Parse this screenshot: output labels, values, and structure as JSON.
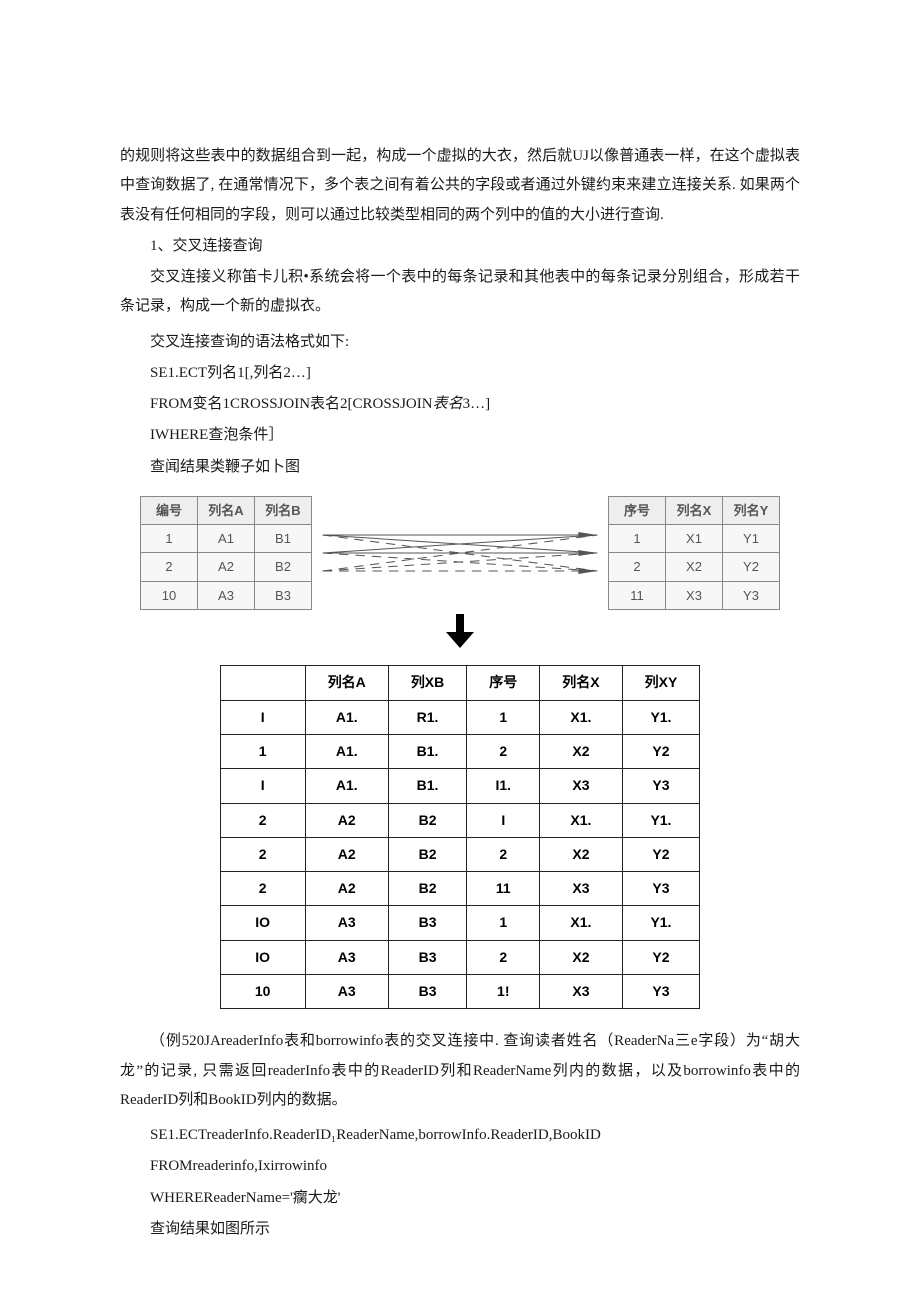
{
  "p1": "的规则将这些表中的数据组合到一起，构成一个虚拟的大衣，然后就UJ以像普通表一样，在这个虚拟表中查询数据了, 在通常情况下，多个表之间有着公共的字段或者通过外键约束来建立连接关系. 如果两个表没有任何相同的字段，则可以通过比较类型相同的两个列中的值的大小进行查询.",
  "h1": "1、交叉连接查询",
  "p2": "交叉连接义称笛卡儿积•系统会将一个表中的每条记录和其他表中的每条记录分別组合，形成若干条记录，构成一个新的虚拟衣。",
  "p3": "交叉连接查询的语法格式如下:",
  "code1": "SE1.ECT列名1[,列名2…]",
  "code2_a": "FROM变名1CROSSJOIN表名2[CROSSJOIN",
  "code2_b": "表名",
  "code2_c": "3…]",
  "code3": "IWHERE查泡条件］",
  "p4": "查闻结果类鞭子如卜图",
  "leftTable": {
    "headers": [
      "编号",
      "列名A",
      "列名B"
    ],
    "rows": [
      [
        "1",
        "A1",
        "B1"
      ],
      [
        "2",
        "A2",
        "B2"
      ],
      [
        "10",
        "A3",
        "B3"
      ]
    ]
  },
  "rightTable": {
    "headers": [
      "序号",
      "列名X",
      "列名Y"
    ],
    "rows": [
      [
        "1",
        "X1",
        "Y1"
      ],
      [
        "2",
        "X2",
        "Y2"
      ],
      [
        "11",
        "X3",
        "Y3"
      ]
    ]
  },
  "resultTable": {
    "headers": [
      "",
      "列名A",
      "列XB",
      "序号",
      "列名X",
      "列XY"
    ],
    "rows": [
      [
        "I",
        "A1.",
        "R1.",
        "1",
        "X1.",
        "Y1."
      ],
      [
        "1",
        "A1.",
        "B1.",
        "2",
        "X2",
        "Y2"
      ],
      [
        "I",
        "A1.",
        "B1.",
        "I1.",
        "X3",
        "Y3"
      ],
      [
        "2",
        "A2",
        "B2",
        "I",
        "X1.",
        "Y1."
      ],
      [
        "2",
        "A2",
        "B2",
        "2",
        "X2",
        "Y2"
      ],
      [
        "2",
        "A2",
        "B2",
        "11",
        "X3",
        "Y3"
      ],
      [
        "IO",
        "A3",
        "B3",
        "1",
        "X1.",
        "Y1."
      ],
      [
        "IO",
        "A3",
        "B3",
        "2",
        "X2",
        "Y2"
      ],
      [
        "10",
        "A3",
        "B3",
        "1!",
        "X3",
        "Y3"
      ]
    ]
  },
  "p5": "（例520JAreaderInfo表和borrowinfo表的交叉连接中. 查询读者姓名（ReaderNa三e字段）为“胡大龙”的记录, 只需返回readerInfo表中的ReaderID列和ReaderName列内的数据，以及borrowinfo表中的ReaderID列和BookID列内的数据。",
  "code4": "SE1.ECTreaderInfo.ReaderID₁ReaderName,borrowInfo.ReaderID,BookID",
  "code5": "FROMreaderinfo,Ixirrowinfo",
  "code6": "WHEREReaderName='瘸大龙'",
  "p6": "查询结果如图所示"
}
